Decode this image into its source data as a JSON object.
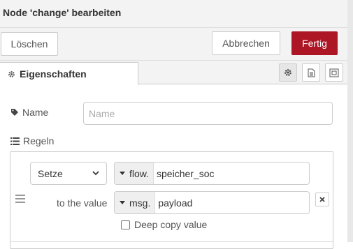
{
  "dialog": {
    "title": "Node 'change' bearbeiten",
    "buttons": {
      "delete": "Löschen",
      "cancel": "Abbrechen",
      "done": "Fertig"
    },
    "accent_color": "#ad1625"
  },
  "tabs": {
    "properties": "Eigenschaften"
  },
  "tab_icons": [
    "gear-icon",
    "document-icon",
    "frame-icon"
  ],
  "form": {
    "name_label": "Name",
    "name_placeholder": "Name",
    "name_value": "",
    "rules_label": "Regeln"
  },
  "rule": {
    "action": "Setze",
    "target_type": "flow.",
    "target_value": "speicher_soc",
    "to_label": "to the value",
    "source_type": "msg.",
    "source_value": "payload",
    "deep_copy_label": "Deep copy value",
    "deep_copy_checked": false
  }
}
